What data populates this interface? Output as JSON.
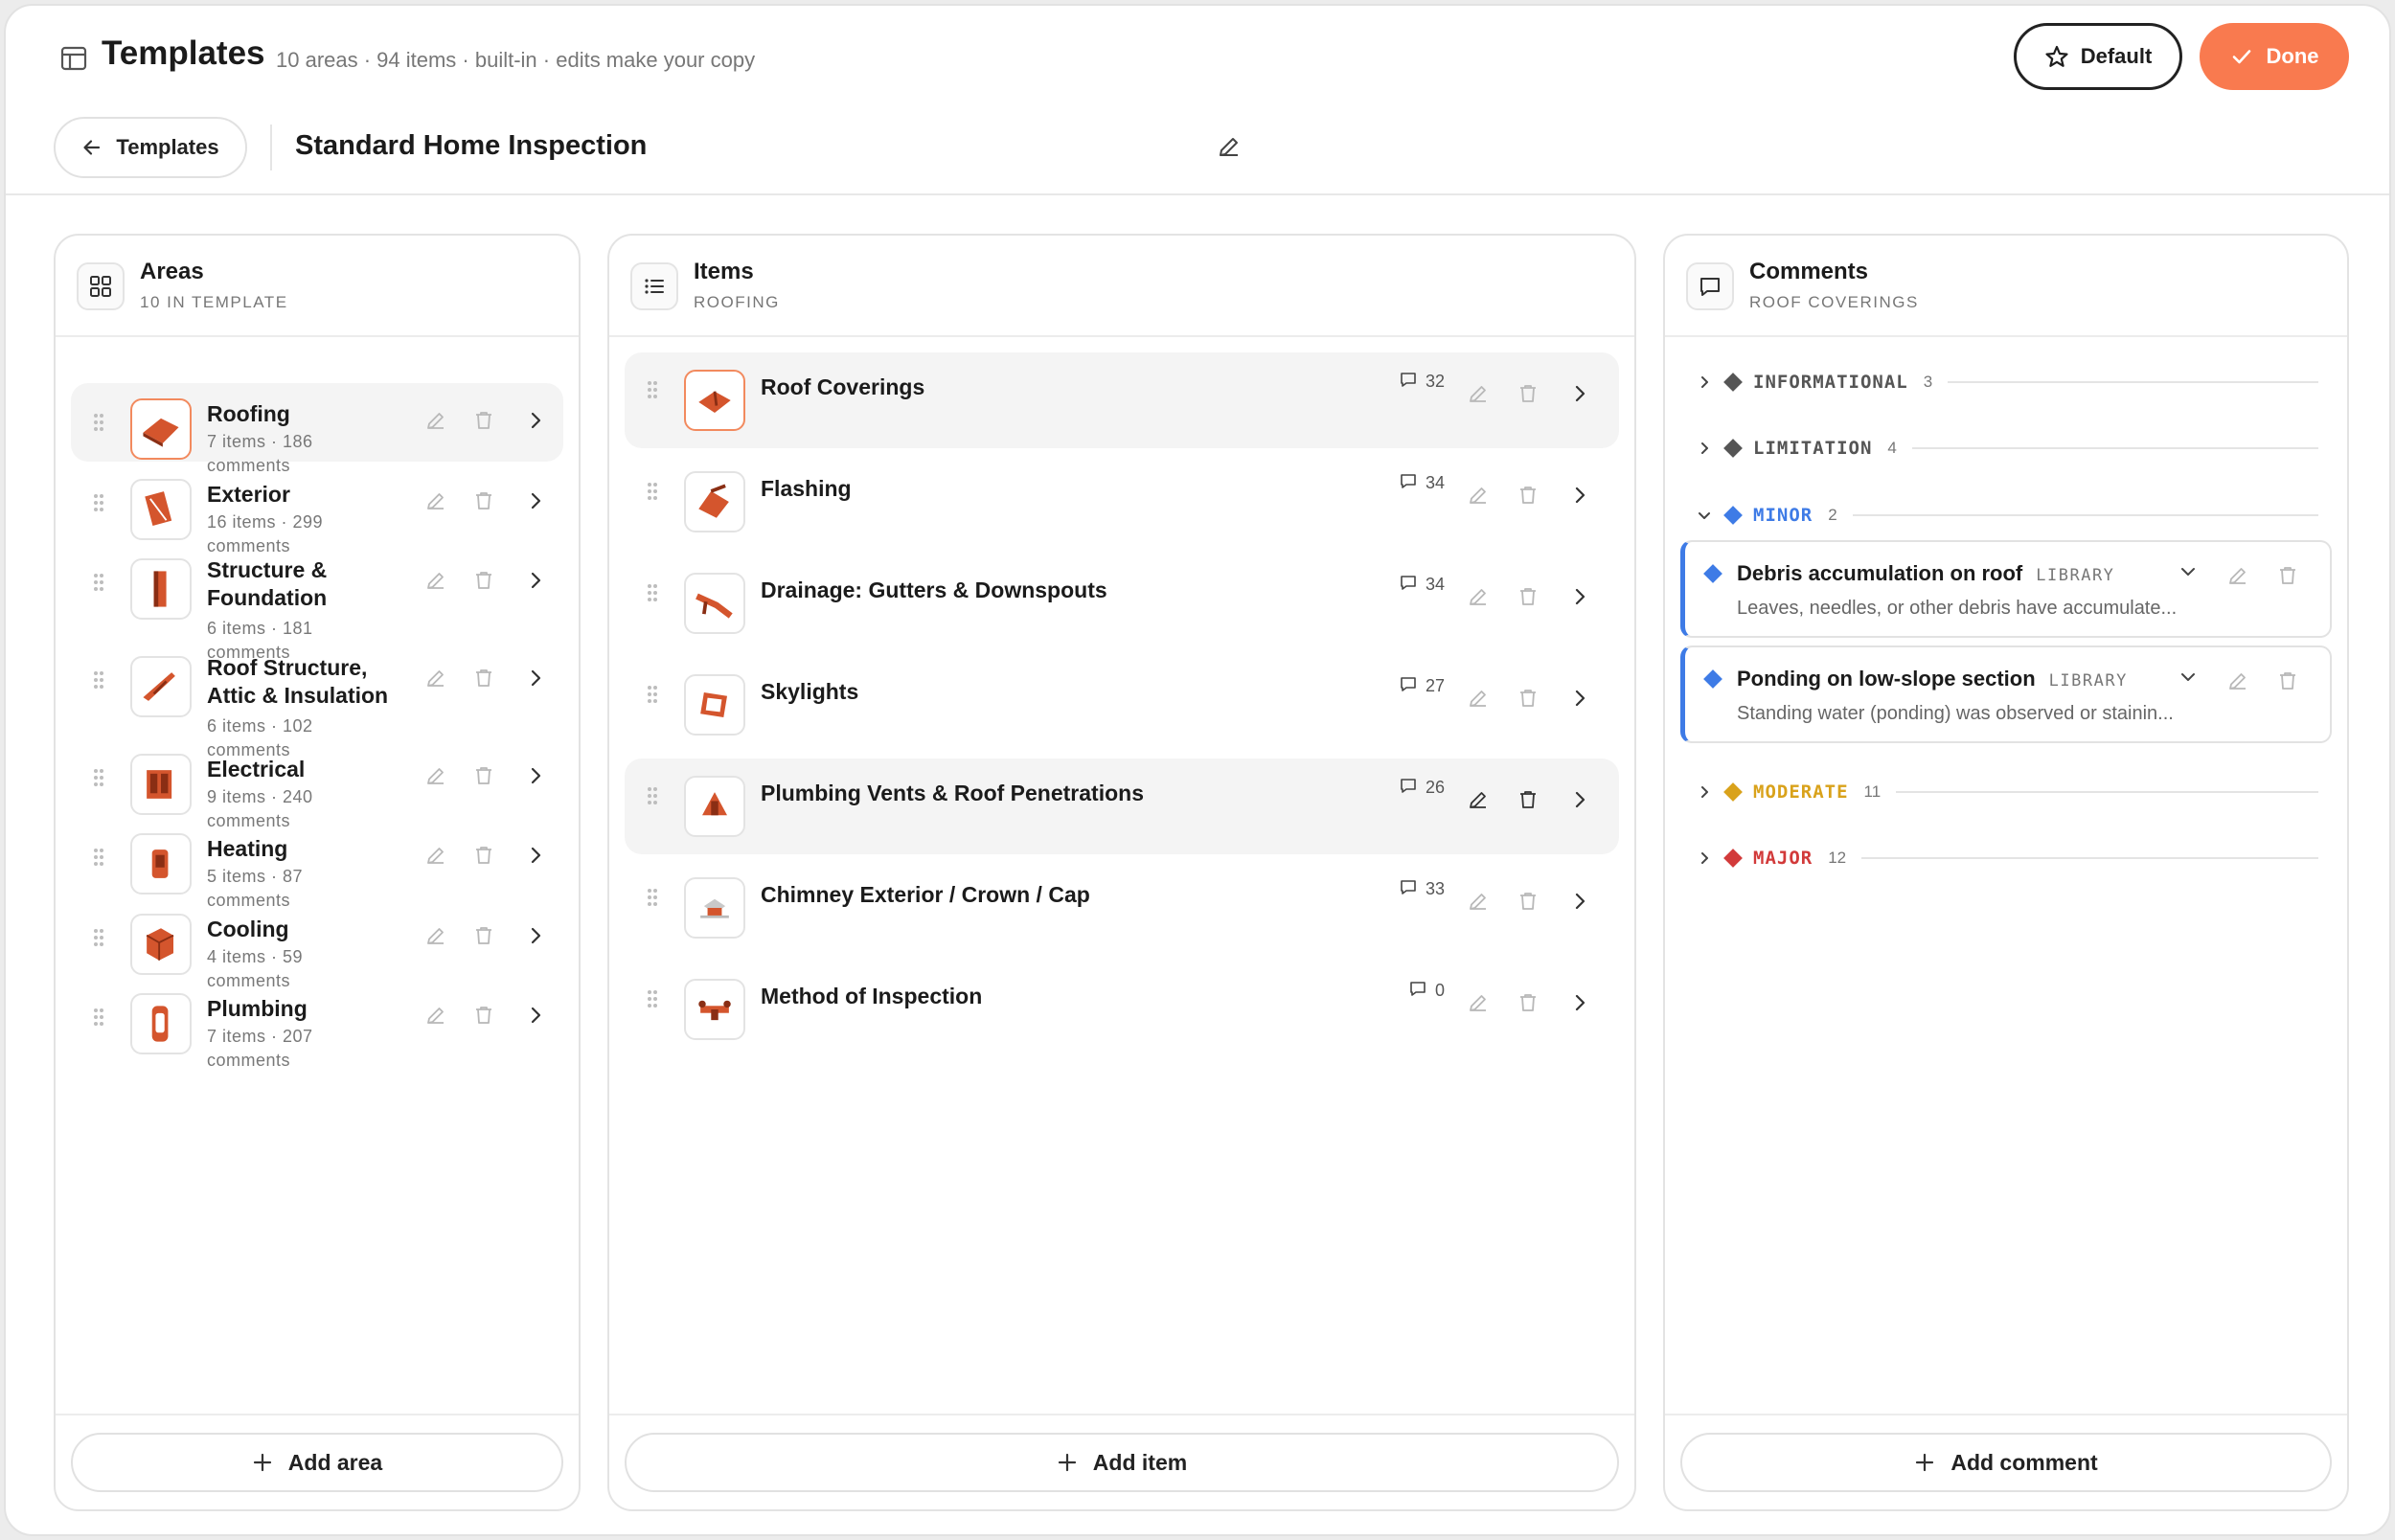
{
  "header": {
    "title": "Templates",
    "subtitle": "10 areas · 94 items · built-in · edits make your copy",
    "default_label": "Default",
    "done_label": "Done",
    "back_label": "Templates",
    "template_name": "Standard Home Inspection"
  },
  "colors": {
    "accent": "#f97a4f",
    "minor": "#3e7be6",
    "moderate": "#d9a21b",
    "major": "#d23a3a",
    "neutral_sev": "#555555"
  },
  "areas": {
    "title": "Areas",
    "subtitle": "10 IN TEMPLATE",
    "add_label": "Add area",
    "items": [
      {
        "name": "Roofing",
        "meta1": "7 items · 186",
        "meta2": "comments",
        "icon": "roof-icon"
      },
      {
        "name": "Exterior",
        "meta1": "16 items · 299",
        "meta2": "comments",
        "icon": "siding-icon"
      },
      {
        "name1": "Structure &",
        "name2": "Foundation",
        "meta1": "6 items · 181",
        "meta2": "comments",
        "icon": "column-icon"
      },
      {
        "name1": "Roof Structure,",
        "name2": "Attic & Insulation",
        "meta1": "6 items · 102",
        "meta2": "comments",
        "icon": "rafter-icon"
      },
      {
        "name": "Electrical",
        "meta1": "9 items · 240",
        "meta2": "comments",
        "icon": "electrical-panel-icon"
      },
      {
        "name": "Heating",
        "meta1": "5 items · 87",
        "meta2": "comments",
        "icon": "heater-icon"
      },
      {
        "name": "Cooling",
        "meta1": "4 items · 59",
        "meta2": "comments",
        "icon": "ac-unit-icon"
      },
      {
        "name": "Plumbing",
        "meta1": "7 items · 207",
        "meta2": "comments",
        "icon": "water-heater-icon"
      }
    ]
  },
  "items": {
    "title": "Items",
    "subtitle": "ROOFING",
    "add_label": "Add item",
    "list": [
      {
        "name": "Roof Coverings",
        "count": "32"
      },
      {
        "name": "Flashing",
        "count": "34"
      },
      {
        "name": "Drainage: Gutters & Downspouts",
        "count": "34"
      },
      {
        "name": "Skylights",
        "count": "27"
      },
      {
        "name": "Plumbing Vents & Roof Penetrations",
        "count": "26"
      },
      {
        "name": "Chimney Exterior / Crown / Cap",
        "count": "33"
      },
      {
        "name": "Method of Inspection",
        "count": "0"
      }
    ]
  },
  "comments": {
    "title": "Comments",
    "subtitle": "ROOF COVERINGS",
    "add_label": "Add comment",
    "groups": [
      {
        "label": "INFORMATIONAL",
        "count": "3"
      },
      {
        "label": "LIMITATION",
        "count": "4"
      },
      {
        "label": "MINOR",
        "count": "2"
      },
      {
        "label": "MODERATE",
        "count": "11"
      },
      {
        "label": "MAJOR",
        "count": "12"
      }
    ],
    "cards": [
      {
        "title": "Debris accumulation on roof",
        "tag": "LIBRARY",
        "body": "Leaves, needles, or other debris have accumulate..."
      },
      {
        "title": "Ponding on low-slope section",
        "tag": "LIBRARY",
        "body": "Standing water (ponding) was observed or stainin..."
      }
    ]
  }
}
